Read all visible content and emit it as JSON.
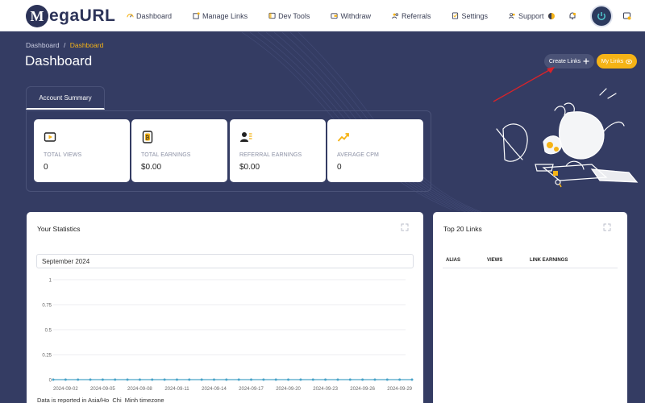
{
  "logo": {
    "letter": "M",
    "text": "egaURL"
  },
  "nav": {
    "items": [
      {
        "label": "Dashboard",
        "icon": "dashboard-icon"
      },
      {
        "label": "Manage Links",
        "icon": "link-icon"
      },
      {
        "label": "Dev Tools",
        "icon": "code-icon"
      },
      {
        "label": "Withdraw",
        "icon": "wallet-icon"
      },
      {
        "label": "Referrals",
        "icon": "users-icon"
      },
      {
        "label": "Settings",
        "icon": "settings-icon"
      },
      {
        "label": "Support",
        "icon": "support-icon"
      }
    ],
    "right_icons": [
      "theme-icon",
      "notification-bell-icon",
      "power-icon",
      "settings-gear-icon"
    ]
  },
  "breadcrumb": {
    "root": "Dashboard",
    "separator": "/",
    "current": "Dashboard"
  },
  "page": {
    "title": "Dashboard"
  },
  "actions": {
    "create_links": "Create Links",
    "my_links": "My Links"
  },
  "summary": {
    "tab": "Account Summary",
    "cards": [
      {
        "label": "TOTAL VIEWS",
        "value": "0",
        "icon": "play-icon"
      },
      {
        "label": "TOTAL EARNINGS",
        "value": "$0.00",
        "icon": "bitcoin-icon"
      },
      {
        "label": "REFERRAL EARNINGS",
        "value": "$0.00",
        "icon": "user-list-icon"
      },
      {
        "label": "AVERAGE CPM",
        "value": "0",
        "icon": "trend-up-icon"
      }
    ]
  },
  "stats": {
    "title": "Your Statistics",
    "month": "September 2024",
    "timezone_note": "Data is reported in Asia/Ho_Chi_Minh timezone"
  },
  "chart_data": {
    "type": "line",
    "x": [
      "2024-09-01",
      "2024-09-02",
      "2024-09-03",
      "2024-09-04",
      "2024-09-05",
      "2024-09-06",
      "2024-09-07",
      "2024-09-08",
      "2024-09-09",
      "2024-09-10",
      "2024-09-11",
      "2024-09-12",
      "2024-09-13",
      "2024-09-14",
      "2024-09-15",
      "2024-09-16",
      "2024-09-17",
      "2024-09-18",
      "2024-09-19",
      "2024-09-20",
      "2024-09-21",
      "2024-09-22",
      "2024-09-23",
      "2024-09-24",
      "2024-09-25",
      "2024-09-26",
      "2024-09-27",
      "2024-09-28",
      "2024-09-29",
      "2024-09-30"
    ],
    "x_tick_labels": [
      "2024-09-02",
      "2024-09-05",
      "2024-09-08",
      "2024-09-11",
      "2024-09-14",
      "2024-09-17",
      "2024-09-20",
      "2024-09-23",
      "2024-09-26",
      "2024-09-29"
    ],
    "y_tick_labels": [
      "1",
      "0.75",
      "0.5",
      "0.25",
      "0"
    ],
    "series": [
      {
        "values": [
          0,
          0,
          0,
          0,
          0,
          0,
          0,
          0,
          0,
          0,
          0,
          0,
          0,
          0,
          0,
          0,
          0,
          0,
          0,
          0,
          0,
          0,
          0,
          0,
          0,
          0,
          0,
          0,
          0,
          0
        ]
      }
    ],
    "ylim": [
      0,
      1
    ],
    "grid": true,
    "line_color": "#4aa3c8"
  },
  "top_links": {
    "title": "Top 20 Links",
    "columns": [
      "ALIAS",
      "VIEWS",
      "LINK EARNINGS"
    ]
  },
  "colors": {
    "background": "#343c63",
    "accent": "#f5b316",
    "panel": "#ffffff"
  }
}
